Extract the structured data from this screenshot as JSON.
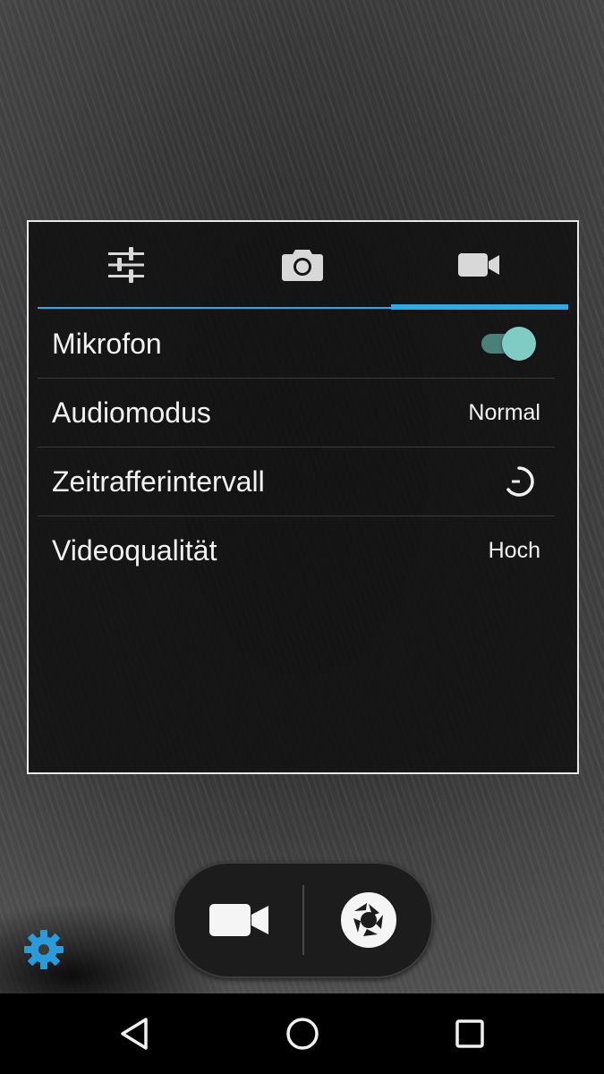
{
  "tabs": [
    {
      "icon": "sliders-icon",
      "name": "general-settings"
    },
    {
      "icon": "camera-icon",
      "name": "photo-settings"
    },
    {
      "icon": "video-camera-icon",
      "name": "video-settings",
      "selected": true
    }
  ],
  "video_settings": {
    "microphone": {
      "label": "Mikrofon",
      "enabled": true
    },
    "audio_mode": {
      "label": "Audiomodus",
      "value": "Normal"
    },
    "timelapse": {
      "label": "Zeitrafferintervall",
      "icon": "timer-icon"
    },
    "video_quality": {
      "label": "Videoqualität",
      "value": "Hoch"
    }
  },
  "capture_bar": {
    "video_button_icon": "video-camera-icon",
    "shutter_button_icon": "shutter-icon"
  },
  "settings_button_icon": "gear-icon",
  "navbar": {
    "back_icon": "back-triangle-icon",
    "home_icon": "home-circle-icon",
    "recent_icon": "recent-square-icon"
  },
  "colors": {
    "accent": "#33a9e0",
    "toggle_on": "#80cbc4",
    "gear": "#2a9ad8"
  }
}
